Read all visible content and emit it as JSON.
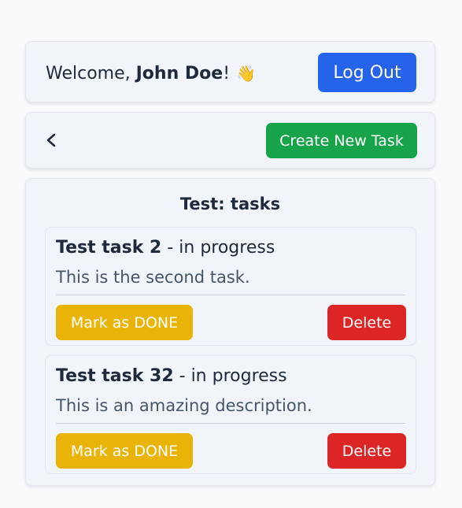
{
  "header": {
    "welcome_prefix": "Welcome, ",
    "user_name": "John Doe",
    "welcome_suffix": "!",
    "wave_emoji": "👋",
    "logout_label": "Log Out"
  },
  "nav": {
    "back_icon": "chevron-left-icon",
    "create_label": "Create New Task"
  },
  "list": {
    "title": "Test: tasks",
    "tasks": [
      {
        "name": "Test task 2",
        "status": " - in progress",
        "description": "This is the second task.",
        "done_label": "Mark as DONE",
        "delete_label": "Delete"
      },
      {
        "name": "Test task 32",
        "status": " - in progress",
        "description": "This is an amazing description.",
        "done_label": "Mark as DONE",
        "delete_label": "Delete"
      }
    ]
  },
  "colors": {
    "logout": "#2563eb",
    "create": "#16a34a",
    "mark_done": "#eab308",
    "delete": "#dc2626"
  }
}
